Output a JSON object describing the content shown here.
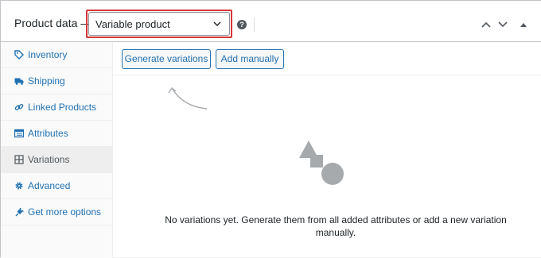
{
  "header": {
    "title": "Product data —",
    "product_type": "Variable product",
    "help_icon": "question-circle-icon",
    "buttons": [
      "chevron-up-icon",
      "chevron-down-icon",
      "collapse-triangle-icon"
    ]
  },
  "sidebar": {
    "items": [
      {
        "label": "Inventory",
        "icon": "tag-icon"
      },
      {
        "label": "Shipping",
        "icon": "truck-icon"
      },
      {
        "label": "Linked Products",
        "icon": "link-icon"
      },
      {
        "label": "Attributes",
        "icon": "list-table-icon"
      },
      {
        "label": "Variations",
        "icon": "grid-icon",
        "active": true
      },
      {
        "label": "Advanced",
        "icon": "gear-icon"
      },
      {
        "label": "Get more options",
        "icon": "plugin-icon"
      }
    ]
  },
  "toolbar": {
    "generate_label": "Generate variations",
    "add_label": "Add manually"
  },
  "empty_state": {
    "icon": "shapes-icon",
    "message": "No variations yet. Generate them from all added attributes or add a new variation manually."
  },
  "colors": {
    "link": "#2271b1",
    "highlight": "#d63638",
    "muted_icon": "#a7aaad"
  }
}
